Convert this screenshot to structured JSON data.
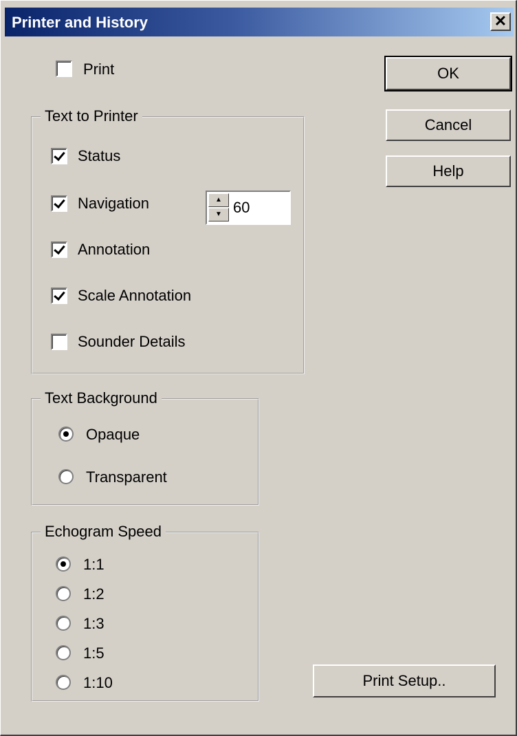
{
  "window": {
    "title": "Printer and History",
    "close_glyph": "✕"
  },
  "print_checkbox": {
    "label": "Print",
    "checked": false
  },
  "text_to_printer": {
    "title": "Text to Printer",
    "items": [
      {
        "label": "Status",
        "checked": true
      },
      {
        "label": "Navigation",
        "checked": true
      },
      {
        "label": "Annotation",
        "checked": true
      },
      {
        "label": "Scale Annotation",
        "checked": true
      },
      {
        "label": "Sounder Details",
        "checked": false
      }
    ],
    "navigation_value": "60"
  },
  "text_background": {
    "title": "Text Background",
    "options": [
      {
        "label": "Opaque",
        "selected": true
      },
      {
        "label": "Transparent",
        "selected": false
      }
    ]
  },
  "echogram_speed": {
    "title": "Echogram Speed",
    "options": [
      {
        "label": "1:1",
        "selected": true
      },
      {
        "label": "1:2",
        "selected": false
      },
      {
        "label": "1:3",
        "selected": false
      },
      {
        "label": "1:5",
        "selected": false
      },
      {
        "label": "1:10",
        "selected": false
      }
    ]
  },
  "buttons": {
    "ok": "OK",
    "cancel": "Cancel",
    "help": "Help",
    "print_setup": "Print Setup.."
  }
}
